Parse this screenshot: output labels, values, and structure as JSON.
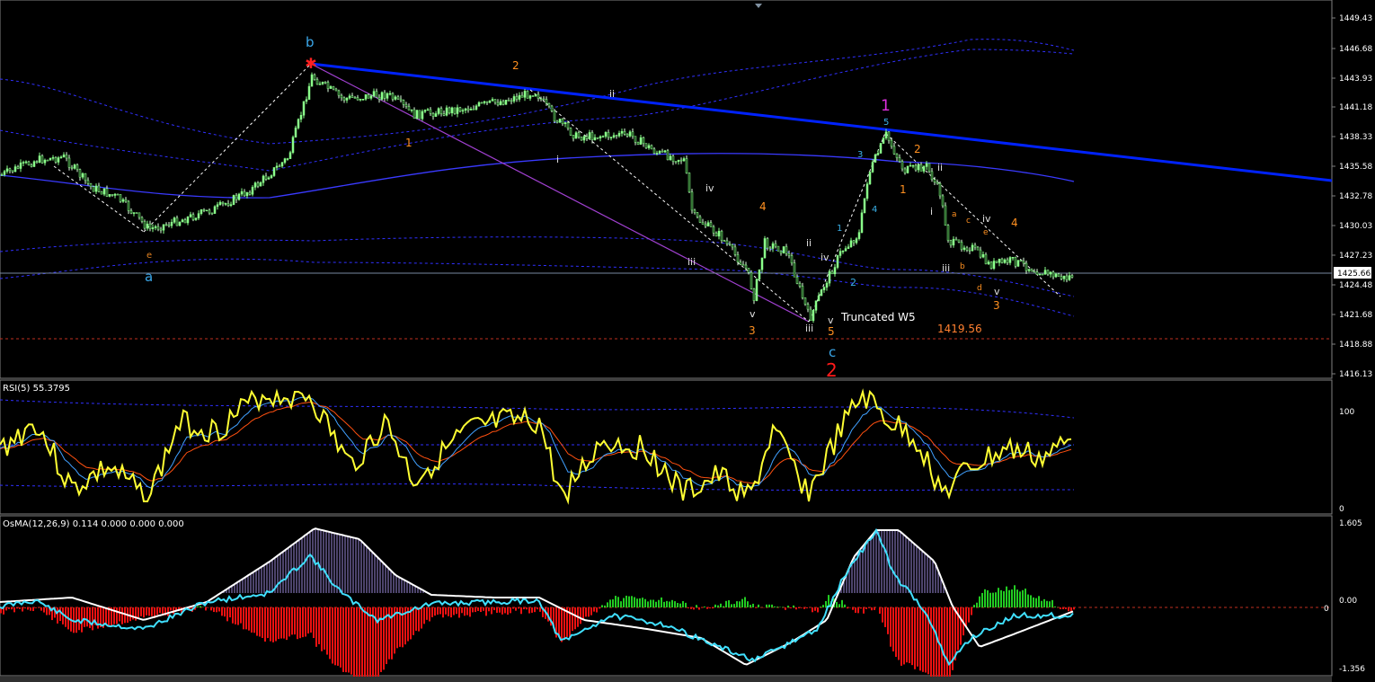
{
  "chart_data": [
    {
      "type": "line",
      "title": "",
      "price_axis": [
        "1449.43",
        "1446.68",
        "1443.93",
        "1441.18",
        "1438.33",
        "1435.58",
        "1432.78",
        "1430.03",
        "1427.23",
        "1424.48",
        "1421.68",
        "1418.88",
        "1416.13"
      ],
      "ylim": [
        1416.13,
        1449.43
      ],
      "current_price": "1425.66",
      "level_line": "1419.56",
      "annotation": "Truncated W5",
      "wave_labels": {
        "b": "b",
        "a": "a",
        "c": "c",
        "two_red": "2",
        "one_magenta": "1",
        "e": "e",
        "orange_2": "2",
        "orange_1": "1",
        "orange_4": "4",
        "orange_3": "3",
        "orange_5": "5",
        "orange_1b": "1",
        "orange_2b": "2",
        "orange_4b": "4",
        "orange_3b": "3",
        "ii": "ii",
        "i": "i",
        "iv": "iv",
        "iii": "iii",
        "v": "v",
        "ii2": "ii",
        "iv2": "iv",
        "iii2": "iii",
        "v2": "v",
        "cyan_5": "5",
        "cyan_3": "3",
        "cyan_4": "4",
        "cyan_1": "1",
        "cyan_2": "2",
        "i3": "i",
        "ii3": "ii",
        "iii3": "iii",
        "iv3": "iv",
        "v3": "v",
        "a_small": "a",
        "b_small": "b",
        "c_small": "c",
        "d_small": "d",
        "e_small": "e"
      },
      "colors": {
        "up": "#8aff8a",
        "down": "#ffffff",
        "trend": "#0022ff",
        "bands": "#3a3aff",
        "level": "#c03020"
      }
    },
    {
      "type": "line",
      "title": "RSI(5) 55.3795",
      "axis": [
        "100",
        "0"
      ],
      "ylim": [
        0,
        100
      ],
      "series": [
        {
          "name": "RSI(5)",
          "color": "#ffff33"
        }
      ]
    },
    {
      "type": "bar",
      "title": "OsMA(12,26,9) 0.114 0.000 0.000 0.000",
      "axis": [
        "1.605",
        "0.00",
        "-1.356"
      ],
      "ylim": [
        -1.356,
        1.605
      ],
      "zero_marker": "0",
      "colors": {
        "pos_up": "#22cc22",
        "neg": "#ff1111",
        "hist": "#9080e0"
      }
    }
  ]
}
